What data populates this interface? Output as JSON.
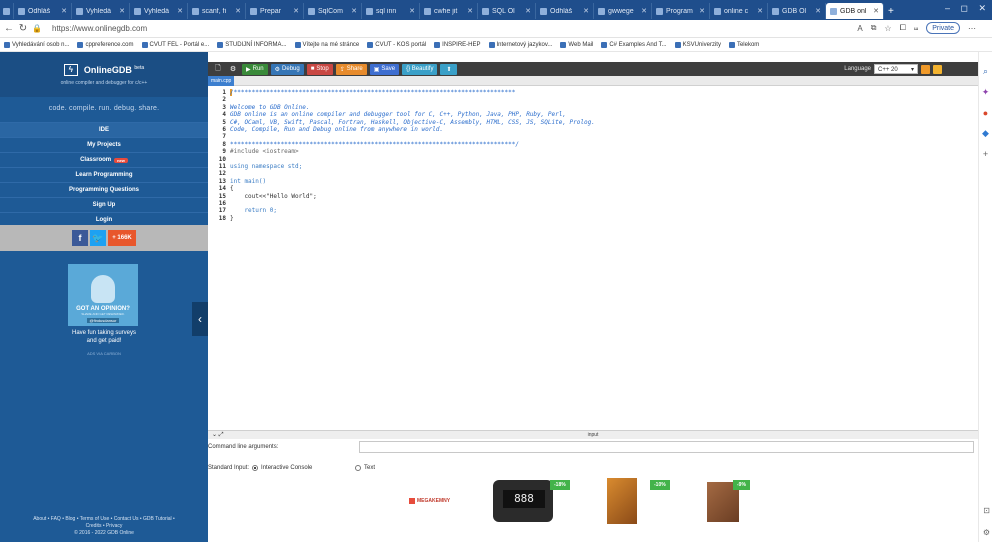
{
  "browser": {
    "tabs": [
      {
        "label": "Odhláš"
      },
      {
        "label": "Vyhledá"
      },
      {
        "label": "Vyhledá"
      },
      {
        "label": "scanf, fi"
      },
      {
        "label": "Prepar"
      },
      {
        "label": "SqlCom"
      },
      {
        "label": "sql inn"
      },
      {
        "label": "cwhe jit"
      },
      {
        "label": "SQL Ol"
      },
      {
        "label": "Odhláš"
      },
      {
        "label": "gwwege"
      },
      {
        "label": "Program"
      },
      {
        "label": "online c"
      },
      {
        "label": "GDB Ol"
      },
      {
        "label": "GDB onl"
      }
    ],
    "url": "https://www.onlinegdb.com",
    "private_label": "Private",
    "bookmarks": [
      "Vyhledávání osob n...",
      "cppreference.com",
      "CVUT FEL - Portál e...",
      "STUDIJNÍ INFORMA...",
      "Vítejte na mé stránce",
      "CVUT - KOS portál",
      "INSPIRE-HEP",
      "Internetový jazykov...",
      "Web Mail",
      "C# Examples And T...",
      "KSVUniverzity",
      "Telekom"
    ]
  },
  "site": {
    "logo_name": "OnlineGDB",
    "logo_beta": "beta",
    "logo_sub": "online compiler and debugger for c/c++",
    "motto": "code. compile. run. debug. share.",
    "menu": [
      {
        "label": "IDE"
      },
      {
        "label": "My Projects"
      },
      {
        "label": "Classroom",
        "badge": "new"
      },
      {
        "label": "Learn Programming"
      },
      {
        "label": "Programming Questions"
      },
      {
        "label": "Sign Up"
      },
      {
        "label": "Login"
      }
    ],
    "social_plus": "+ 166K",
    "ad_title": "GOT AN OPINION?",
    "ad_sub": "SHARE AND GET REWARDED.",
    "ad_brand": "@findusdansur",
    "ad_text_1": "Have fun taking surveys",
    "ad_text_2": "and get paid!",
    "ad_via": "ADS VIA CARBON",
    "footer_1": "About • FAQ • Blog • Terms of Use • Contact Us • GDB Tutorial •",
    "footer_2": "Credits • Privacy",
    "footer_3": "© 2016 - 2022 GDB Online"
  },
  "toolbar": {
    "run": "Run",
    "debug": "Debug",
    "stop": "Stop",
    "share": "Share",
    "save": "Save",
    "beautify": "{} Beautify",
    "language_label": "Language",
    "language_value": "C++ 20"
  },
  "file_tab": "main.cpp",
  "code_lines": [
    {
      "n": "1",
      "t": "/******************************************************************************",
      "c": "cm"
    },
    {
      "n": "2",
      "t": "",
      "c": "cm"
    },
    {
      "n": "3",
      "t": "Welcome to GDB Online.",
      "c": "cm"
    },
    {
      "n": "4",
      "t": "GDB online is an online compiler and debugger tool for C, C++, Python, Java, PHP, Ruby, Perl,",
      "c": "cm"
    },
    {
      "n": "5",
      "t": "C#, OCaml, VB, Swift, Pascal, Fortran, Haskell, Objective-C, Assembly, HTML, CSS, JS, SQLite, Prolog.",
      "c": "cm"
    },
    {
      "n": "6",
      "t": "Code, Compile, Run and Debug online from anywhere in world.",
      "c": "cm"
    },
    {
      "n": "7",
      "t": "",
      "c": "cm"
    },
    {
      "n": "8",
      "t": "*******************************************************************************/",
      "c": "cm"
    },
    {
      "n": "9",
      "t": "#include <iostream>",
      "c": "inc"
    },
    {
      "n": "10",
      "t": "",
      "c": ""
    },
    {
      "n": "11",
      "t": "using namespace std;",
      "c": "kw"
    },
    {
      "n": "12",
      "t": "",
      "c": ""
    },
    {
      "n": "13",
      "t": "int main()",
      "c": "kw"
    },
    {
      "n": "14",
      "t": "{",
      "c": ""
    },
    {
      "n": "15",
      "t": "    cout<<\"Hello World\";",
      "c": "str"
    },
    {
      "n": "16",
      "t": "",
      "c": ""
    },
    {
      "n": "17",
      "t": "    return 0;",
      "c": "ret"
    },
    {
      "n": "18",
      "t": "}",
      "c": ""
    }
  ],
  "io": {
    "title": "input",
    "cmd_label": "Command line arguments:",
    "stdin_label": "Standard Input:",
    "opt_interactive": "Interactive Console",
    "opt_text": "Text"
  },
  "ads": {
    "mega": "MEGAKEMNY",
    "gadget_display": "888",
    "disc1": "-18%",
    "disc2": "-10%",
    "disc3": "-9%"
  },
  "colors": {
    "site_blue": "#1e5a96",
    "toolbar_dark": "#3e3e3e",
    "run_green": "#3a8a3a",
    "stop_red": "#c94843"
  }
}
